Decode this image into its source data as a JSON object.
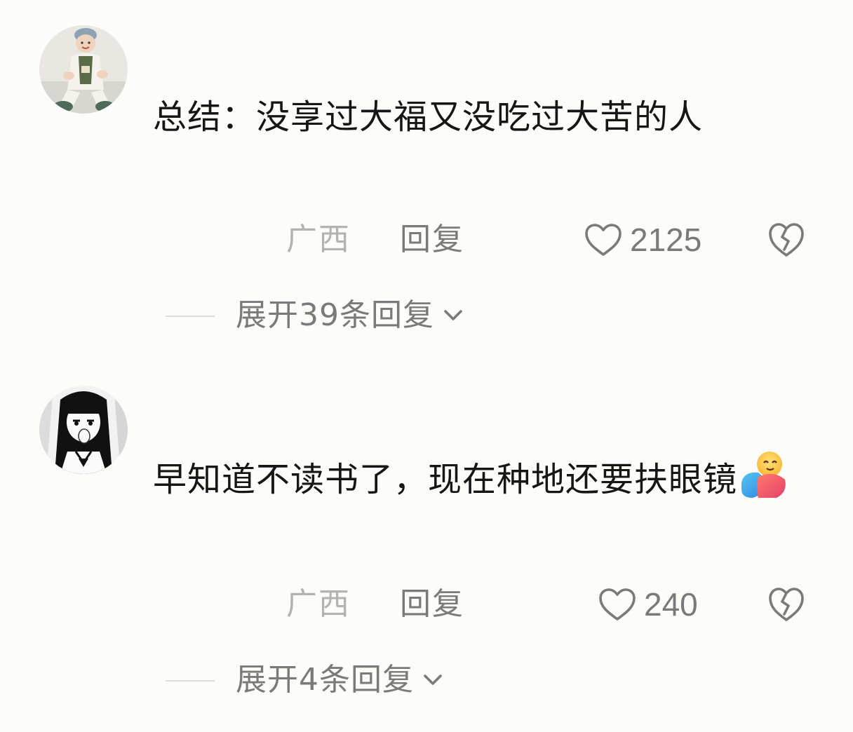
{
  "comments": [
    {
      "avatar_icon": "baby-avatar",
      "text": "总结：没享过大福又没吃过大苦的人",
      "location": "广西",
      "reply_label": "回复",
      "likes": "2125",
      "expand_label": "展开39条回复"
    },
    {
      "avatar_icon": "anime-girl-avatar",
      "text": "早知道不读书了，现在种地还要扶眼镜",
      "emoji": "hugging-face-emoji",
      "location": "广西",
      "reply_label": "回复",
      "likes": "240",
      "expand_label": "展开4条回复"
    }
  ],
  "colors": {
    "background": "#fcfcfa",
    "text_primary": "#161616",
    "text_secondary": "#7a7a7a",
    "text_location": "#b3b3b3"
  }
}
